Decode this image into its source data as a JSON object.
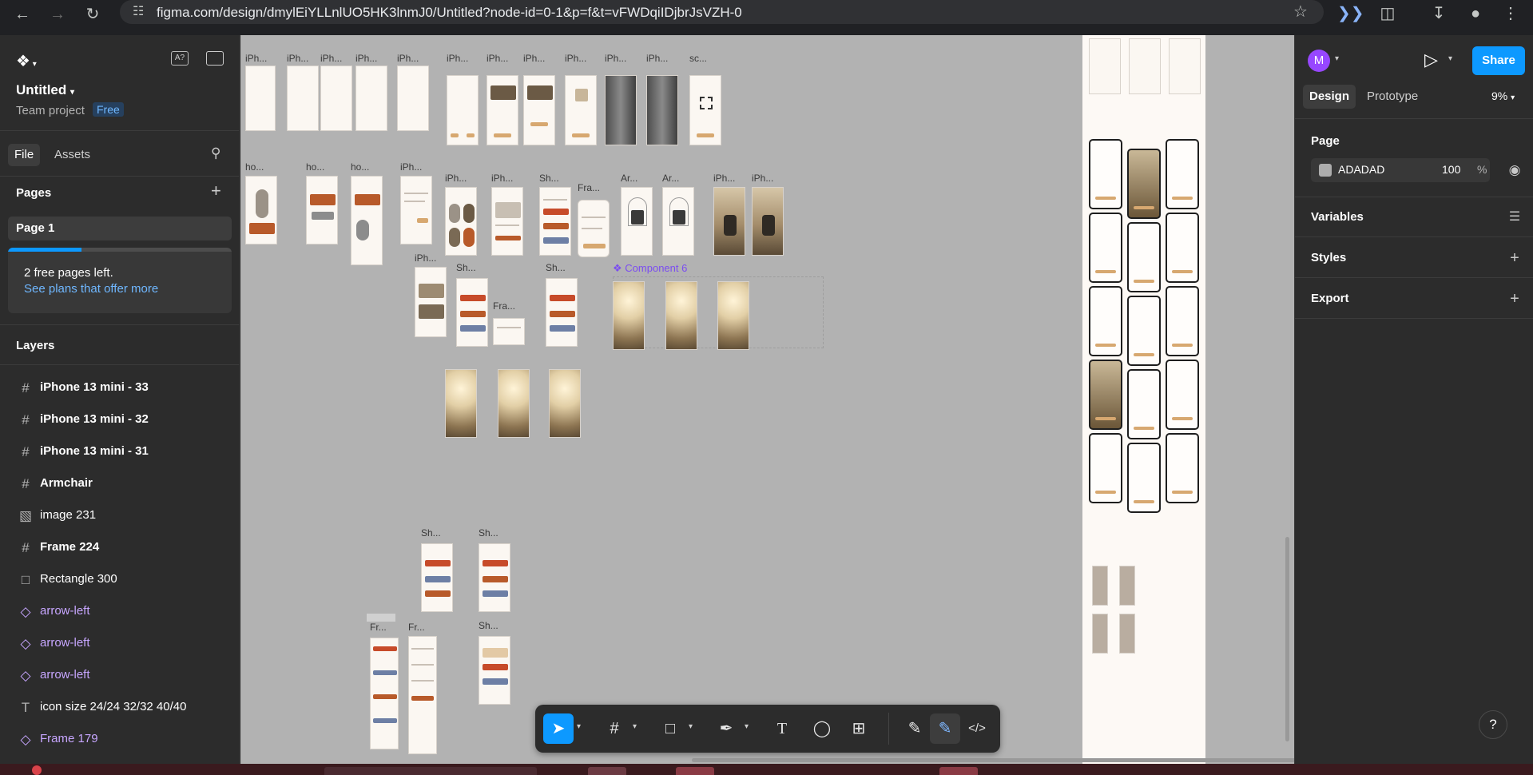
{
  "browser": {
    "url": "figma.com/design/dmylEiYLLnlUO5HK3lnmJ0/Untitled?node-id=0-1&p=f&t=vFWDqiIDjbrJsVZH-0"
  },
  "file": {
    "name": "Untitled",
    "team": "Team project",
    "plan_badge": "Free"
  },
  "left_tabs": [
    "File",
    "Assets"
  ],
  "pages": {
    "title": "Pages",
    "items": [
      "Page 1"
    ],
    "promo_text": "2 free pages left.",
    "promo_link": "See plans that offer more",
    "usage_fraction": 0.33
  },
  "layers": {
    "title": "Layers",
    "items": [
      {
        "label": "iPhone 13 mini - 33",
        "icon": "frame-icon"
      },
      {
        "label": "iPhone 13 mini - 32",
        "icon": "frame-icon"
      },
      {
        "label": "iPhone 13 mini - 31",
        "icon": "frame-icon"
      },
      {
        "label": "Armchair",
        "icon": "frame-icon"
      },
      {
        "label": "image 231",
        "icon": "image-icon"
      },
      {
        "label": "Frame 224",
        "icon": "frame-icon"
      },
      {
        "label": "Rectangle 300",
        "icon": "rectangle-icon"
      },
      {
        "label": "arrow-left",
        "icon": "component-instance-icon"
      },
      {
        "label": "arrow-left",
        "icon": "component-instance-icon"
      },
      {
        "label": "arrow-left",
        "icon": "component-instance-icon"
      },
      {
        "label": "icon size 24/24 32/32 40/40",
        "icon": "text-icon"
      },
      {
        "label": "Frame 179",
        "icon": "component-instance-icon"
      }
    ]
  },
  "canvas": {
    "frame_labels": {
      "r1": [
        "iPh...",
        "iPh...",
        "iPh...",
        "iPh...",
        "iPh...",
        "iPh...",
        "iPh...",
        "iPh...",
        "iPh...",
        "iPh...",
        "iPh...",
        "sc..."
      ],
      "r2": [
        "ho...",
        "ho...",
        "ho...",
        "iPh...",
        "iPh...",
        "iPh...",
        "Sh...",
        "Fra...",
        "Ar...",
        "Ar...",
        "iPh...",
        "iPh..."
      ],
      "r3": [
        "iPh...",
        "Sh...",
        "Sh...",
        "Fra..."
      ],
      "r4": [
        "Sh...",
        "Sh...",
        "Fr...",
        "Fr...",
        "Sh..."
      ]
    },
    "component_label": "Component 6"
  },
  "toolbar": {
    "tools": [
      "move-tool",
      "frame-tool",
      "shape-tool",
      "pen-tool",
      "text-tool",
      "comment-tool",
      "actions-tool",
      "draw-mode",
      "design-mode",
      "dev-mode"
    ]
  },
  "right_panel": {
    "avatar_initial": "M",
    "share_label": "Share",
    "tabs": [
      "Design",
      "Prototype"
    ],
    "zoom": "9%",
    "page_section": "Page",
    "page_color": "ADADAD",
    "page_opacity": "100",
    "opacity_unit": "%",
    "sections": [
      "Variables",
      "Styles",
      "Export"
    ]
  },
  "help_label": "?",
  "colors": {
    "accent": "#0d99ff",
    "component": "#9747ff",
    "canvas_bg": "#b2b2b2"
  }
}
